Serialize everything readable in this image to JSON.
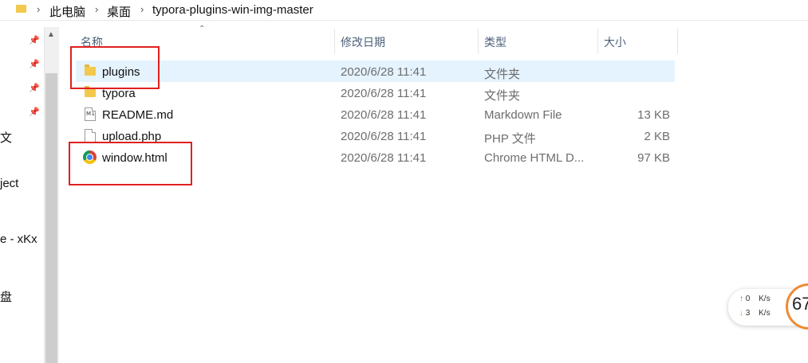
{
  "address_bar": {
    "icon": "folder-icon",
    "path": [
      "此电脑",
      "桌面",
      "typora-plugins-win-img-master"
    ]
  },
  "nav_pane": {
    "items": [
      "文",
      "ject",
      "e - xKx",
      "盘"
    ]
  },
  "columns": {
    "name": "名称",
    "date": "修改日期",
    "type": "类型",
    "size": "大小"
  },
  "files": [
    {
      "name": "plugins",
      "date": "2020/6/28 11:41",
      "type": "文件夹",
      "size": "",
      "icon": "folder-icon",
      "selected": true
    },
    {
      "name": "typora",
      "date": "2020/6/28 11:41",
      "type": "文件夹",
      "size": "",
      "icon": "folder-icon",
      "selected": false
    },
    {
      "name": "README.md",
      "date": "2020/6/28 11:41",
      "type": "Markdown File",
      "size": "13 KB",
      "icon": "markdown-file-icon",
      "selected": false
    },
    {
      "name": "upload.php",
      "date": "2020/6/28 11:41",
      "type": "PHP 文件",
      "size": "2 KB",
      "icon": "php-file-icon",
      "selected": false
    },
    {
      "name": "window.html",
      "date": "2020/6/28 11:41",
      "type": "Chrome HTML D...",
      "size": "97 KB",
      "icon": "chrome-html-icon",
      "selected": false
    }
  ],
  "network_widget": {
    "upload": "0",
    "upload_unit": "K/s",
    "download": "3",
    "download_unit": "K/s",
    "gauge": "67"
  },
  "colors": {
    "selection": "#e5f3ff",
    "highlight_box": "#e02020",
    "header_text": "#4c607a"
  }
}
